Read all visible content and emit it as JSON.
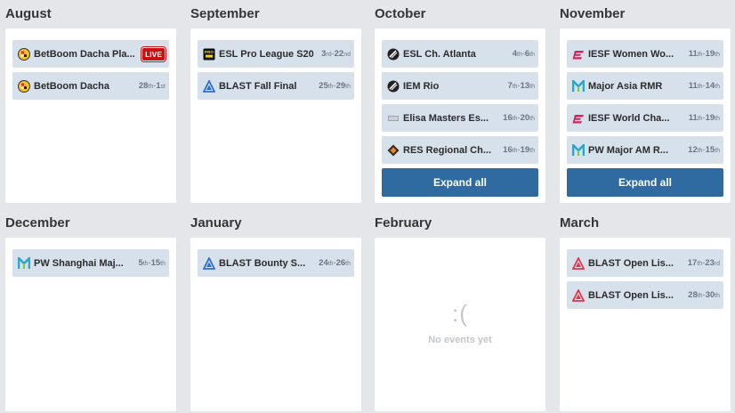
{
  "months": [
    {
      "title": "August",
      "events": [
        {
          "name": "BetBoom Dacha Pla...",
          "live": "LIVE",
          "icon": "betboom-logo-icon"
        },
        {
          "name": "BetBoom Dacha",
          "d1": "28",
          "s1": "th",
          "sep": "-",
          "d2": "1",
          "s2": "st",
          "icon": "betboom-logo-icon"
        }
      ]
    },
    {
      "title": "September",
      "events": [
        {
          "name": "ESL Pro League S20",
          "d1": "3",
          "s1": "rd",
          "sep": "-",
          "d2": "22",
          "s2": "nd",
          "icon": "esl-pro-league-logo-icon"
        },
        {
          "name": "BLAST Fall Final",
          "d1": "25",
          "s1": "th",
          "sep": "-",
          "d2": "29",
          "s2": "th",
          "icon": "blast-logo-icon"
        }
      ]
    },
    {
      "title": "October",
      "events": [
        {
          "name": "ESL Ch. Atlanta",
          "d1": "4",
          "s1": "th",
          "sep": "-",
          "d2": "6",
          "s2": "th",
          "icon": "esl-logo-icon"
        },
        {
          "name": "IEM Rio",
          "d1": "7",
          "s1": "th",
          "sep": "-",
          "d2": "13",
          "s2": "th",
          "icon": "iem-logo-icon"
        },
        {
          "name": "Elisa Masters Es...",
          "d1": "16",
          "s1": "th",
          "sep": "-",
          "d2": "20",
          "s2": "th",
          "icon": "elisa-logo-icon"
        },
        {
          "name": "RES Regional Ch...",
          "d1": "16",
          "s1": "th",
          "sep": "-",
          "d2": "19",
          "s2": "th",
          "icon": "res-logo-icon"
        }
      ],
      "expand": "Expand all"
    },
    {
      "title": "November",
      "events": [
        {
          "name": "IESF Women Wo...",
          "d1": "11",
          "s1": "th",
          "sep": "-",
          "d2": "19",
          "s2": "th",
          "icon": "iesf-logo-icon"
        },
        {
          "name": "Major Asia RMR",
          "d1": "11",
          "s1": "th",
          "sep": "-",
          "d2": "14",
          "s2": "th",
          "icon": "perfect-world-logo-icon"
        },
        {
          "name": "IESF World Cha...",
          "d1": "11",
          "s1": "th",
          "sep": "-",
          "d2": "19",
          "s2": "th",
          "icon": "iesf-logo-icon"
        },
        {
          "name": "PW Major AM R...",
          "d1": "12",
          "s1": "th",
          "sep": "-",
          "d2": "15",
          "s2": "th",
          "icon": "perfect-world-logo-icon"
        }
      ],
      "expand": "Expand all"
    },
    {
      "title": "December",
      "events": [
        {
          "name": "PW Shanghai Maj...",
          "d1": "5",
          "s1": "th",
          "sep": "-",
          "d2": "15",
          "s2": "th",
          "icon": "perfect-world-logo-icon"
        }
      ]
    },
    {
      "title": "January",
      "events": [
        {
          "name": "BLAST Bounty S...",
          "d1": "24",
          "s1": "th",
          "sep": "-",
          "d2": "26",
          "s2": "th",
          "icon": "blast-logo-icon"
        }
      ]
    },
    {
      "title": "February",
      "events": [],
      "empty": {
        "face": ":(",
        "message": "No events yet"
      }
    },
    {
      "title": "March",
      "events": [
        {
          "name": "BLAST Open Lis...",
          "d1": "17",
          "s1": "th",
          "sep": "-",
          "d2": "23",
          "s2": "rd",
          "icon": "blast-open-logo-icon"
        },
        {
          "name": "BLAST Open Lis...",
          "d1": "28",
          "s1": "th",
          "sep": "-",
          "d2": "30",
          "s2": "th",
          "icon": "blast-open-logo-icon"
        }
      ]
    }
  ]
}
